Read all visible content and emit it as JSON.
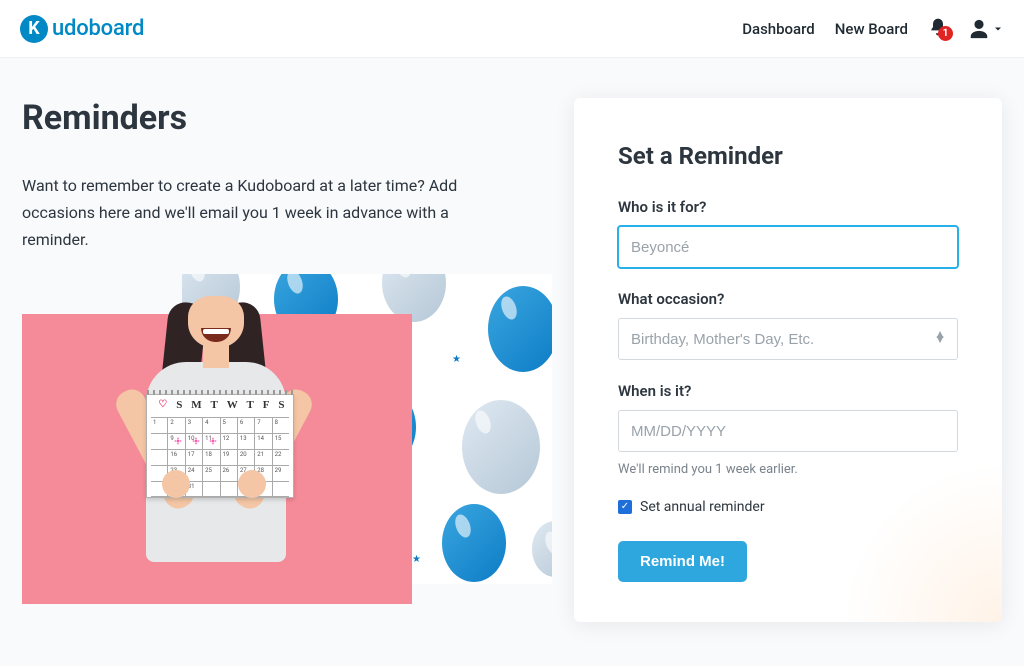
{
  "nav": {
    "brand": "udoboard",
    "brand_letter": "K",
    "dashboard": "Dashboard",
    "new_board": "New Board",
    "notifications_count": "1"
  },
  "left": {
    "title": "Reminders",
    "description": "Want to remember to create a Kudoboard at a later time? Add occasions here and we'll email you 1 week in advance with a reminder."
  },
  "calendar_days": [
    "S",
    "M",
    "T",
    "W",
    "T",
    "F",
    "S"
  ],
  "form": {
    "title": "Set a Reminder",
    "who_label": "Who is it for?",
    "who_placeholder": "Beyoncé",
    "occasion_label": "What occasion?",
    "occasion_placeholder": "Birthday, Mother's Day, Etc.",
    "when_label": "When is it?",
    "when_placeholder": "MM/DD/YYYY",
    "hint": "We'll remind you 1 week earlier.",
    "annual_label": "Set annual reminder",
    "annual_checked": true,
    "submit": "Remind Me!"
  }
}
